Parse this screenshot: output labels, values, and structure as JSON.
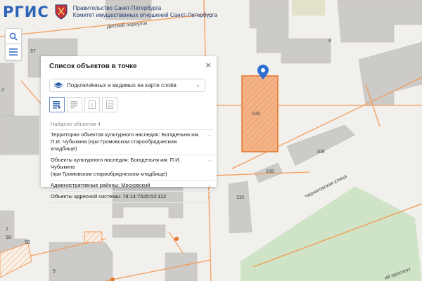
{
  "header": {
    "logo": "РГИС",
    "org_line1": "Правительство Санкт-Петербурга",
    "org_line2": "Комитет имущественных отношений Санкт-Петербурга"
  },
  "controls": {
    "search_icon": "search-icon",
    "menu_icon": "hamburger-menu-icon"
  },
  "map": {
    "street_labels": [
      "Детский переулок",
      "Черниговская улица",
      "ий проспект"
    ],
    "house_numbers": [
      "97",
      "8",
      "2",
      "108",
      "108",
      "108",
      "110",
      "99",
      "99",
      "1",
      "9"
    ],
    "selected_parcel_number": "108",
    "colors": {
      "background": "#f2f0ec",
      "buildings": "#cdcbc8",
      "parcel_lines": "#f39c5a",
      "selected_parcel_fill": "#f4b387",
      "park": "#cfe3c6",
      "marker": "#2e6fd1"
    }
  },
  "panel": {
    "title": "Список объектов в точке",
    "close_symbol": "×",
    "layer_select": "Подключённых и видимых на карте слоёв",
    "found": "Найдено объектов 4",
    "rows": [
      {
        "line1": "Территории объектов культурного наследия: Богадельня им.",
        "line2": "П.И. Чубыкина (при Громовском старообрядческом кладбище)"
      },
      {
        "line1": "Объекты культурного наследия: Богадельня им. П.И. Чубыкина",
        "line2": "(при Громовском старообрядческом кладбище)"
      },
      {
        "line1": "Административные районы: Московский",
        "line2": ""
      },
      {
        "line1": "Объекты адресной системы: 78:14:7525:53:112",
        "line2": ""
      }
    ],
    "chevron": "⌄"
  }
}
